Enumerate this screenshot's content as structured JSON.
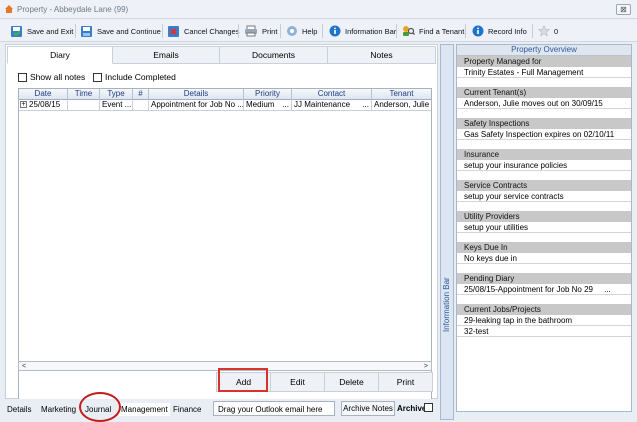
{
  "window": {
    "title": "Property - Abbeydale Lane (99)",
    "close_label": "⊠"
  },
  "toolbar": {
    "save_exit": "Save and Exit",
    "save_continue": "Save and Continue",
    "cancel": "Cancel Changes",
    "print": "Print",
    "help": "Help",
    "info_bar": "Information Bar",
    "find_tenant": "Find a Tenant",
    "record_info": "Record Info",
    "favourite_count": "0"
  },
  "tabs": [
    "Diary",
    "Emails",
    "Documents",
    "Notes"
  ],
  "filters": {
    "show_all": "Show all notes",
    "include_completed": "Include Completed"
  },
  "grid": {
    "columns": [
      "Date",
      "Time",
      "Type",
      "#",
      "Details",
      "Priority",
      "Contact",
      "Tenant"
    ],
    "rows": [
      {
        "date": "25/08/15",
        "time": "",
        "type": "Event ...",
        "num": "",
        "details": "Appointment for Job No ...",
        "priority": "Medium",
        "priority_more": "...",
        "contact": "JJ Maintenance",
        "contact_more": "...",
        "tenant": "Anderson, Julie"
      }
    ]
  },
  "actions": {
    "add": "Add",
    "edit": "Edit",
    "delete": "Delete",
    "print": "Print"
  },
  "bottom_tabs": [
    "Details",
    "Marketing",
    "Journal",
    "Management",
    "Finance"
  ],
  "drag_placeholder": "Drag your Outlook email here",
  "archive_notes": "Archive Notes",
  "archive_label": "Archive",
  "info_bar_label": "Information Bar",
  "overview": {
    "title": "Property Overview",
    "sections": [
      {
        "heading": "Property Managed for",
        "values": [
          "Trinity Estates - Full Management"
        ]
      },
      {
        "heading": "Current Tenant(s)",
        "values": [
          "Anderson, Julie moves out on 30/09/15"
        ]
      },
      {
        "heading": "Safety Inspections",
        "values": [
          "Gas Safety Inspection expires on 02/10/11"
        ]
      },
      {
        "heading": "Insurance",
        "values": [
          "setup your insurance policies"
        ]
      },
      {
        "heading": "Service Contracts",
        "values": [
          "setup your service contracts"
        ]
      },
      {
        "heading": "Utility Providers",
        "values": [
          "setup your utilities"
        ]
      },
      {
        "heading": "Keys Due In",
        "values": [
          "No keys due in"
        ]
      },
      {
        "heading": "Pending Diary",
        "values": [
          "25/08/15-Appointment for Job No 29     ..."
        ]
      },
      {
        "heading": "Current Jobs/Projects",
        "values": [
          "29-leaking tap in the bathroom",
          "32-test"
        ]
      }
    ]
  }
}
